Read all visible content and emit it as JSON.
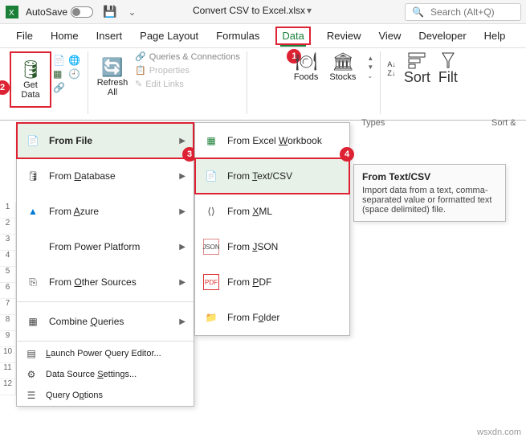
{
  "titlebar": {
    "autosave_label": "AutoSave",
    "filename": "Convert CSV to Excel.xlsx",
    "search_placeholder": "Search (Alt+Q)"
  },
  "menubar": {
    "file": "File",
    "home": "Home",
    "insert": "Insert",
    "page_layout": "Page Layout",
    "formulas": "Formulas",
    "data": "Data",
    "review": "Review",
    "view": "View",
    "developer": "Developer",
    "help": "Help"
  },
  "badges": {
    "b1": "1",
    "b2": "2",
    "b3": "3",
    "b4": "4"
  },
  "ribbon": {
    "get_data": "Get\nData",
    "refresh_all": "Refresh\nAll",
    "queries_connections": "Queries & Connections",
    "properties": "Properties",
    "edit_links": "Edit Links",
    "foods": "Foods",
    "stocks": "Stocks",
    "sort": "Sort",
    "filter": "Filt",
    "group_types": "Types",
    "group_sort": "Sort &"
  },
  "menu1": {
    "from_file": "From File",
    "from_database": "From Database",
    "from_azure": "From Azure",
    "from_power_platform": "From Power Platform",
    "from_other_sources": "From Other Sources",
    "combine_queries": "Combine Queries",
    "launch_pq": "Launch Power Query Editor...",
    "data_source_settings": "Data Source Settings...",
    "query_options": "Query Options"
  },
  "menu2": {
    "from_workbook": "From Excel Workbook",
    "from_text_csv": "From Text/CSV",
    "from_xml": "From XML",
    "from_json": "From JSON",
    "from_pdf": "From PDF",
    "from_folder": "From Folder"
  },
  "tooltip": {
    "title": "From Text/CSV",
    "body": "Import data from a text, comma-separated value or formatted text (space delimited) file."
  },
  "rows": [
    "1",
    "2",
    "3",
    "4",
    "5",
    "6",
    "7",
    "8",
    "9",
    "10",
    "11",
    "12"
  ],
  "watermark": "wsxdn.com"
}
